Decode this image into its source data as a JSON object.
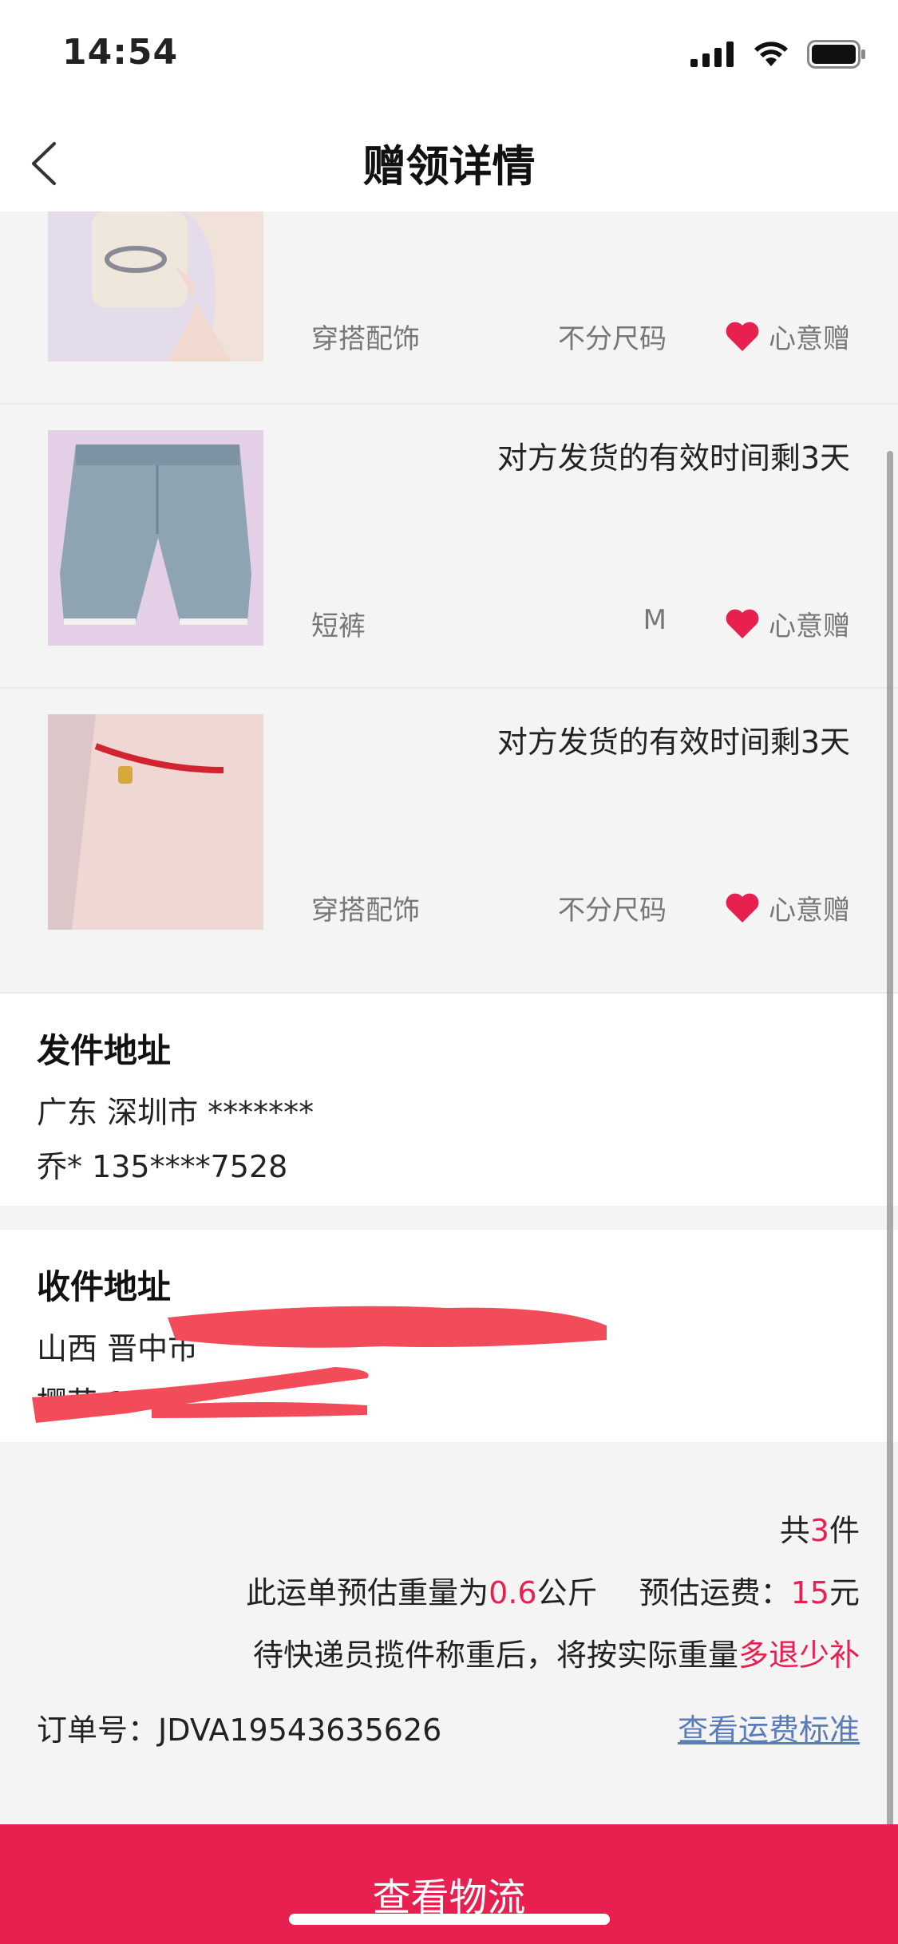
{
  "status_bar": {
    "time": "14:54"
  },
  "nav": {
    "title": "赠领详情"
  },
  "items": [
    {
      "category": "穿搭配饰",
      "size": "不分尺码",
      "badge": "心意赠",
      "remaining": "",
      "image": "ring-photo"
    },
    {
      "category": "短裤",
      "size": "M",
      "badge": "心意赠",
      "remaining": "对方发货的有效时间剩3天",
      "image": "denim-shorts-photo"
    },
    {
      "category": "穿搭配饰",
      "size": "不分尺码",
      "badge": "心意赠",
      "remaining": "对方发货的有效时间剩3天",
      "image": "red-bracelet-photo"
    }
  ],
  "sender": {
    "heading": "发件地址",
    "line1": "广东 深圳市 *******",
    "line2": "乔* 135****7528"
  },
  "receiver": {
    "heading": "收件地址",
    "line1": "山西 晋中市",
    "line2": "樱花 1"
  },
  "summary": {
    "count_prefix": "共",
    "count": "3",
    "count_suffix": "件",
    "weight_prefix": "此运单预估重量为",
    "weight": "0.6",
    "weight_unit": "公斤",
    "fee_prefix": "预估运费：",
    "fee": "15",
    "fee_unit": "元",
    "note_prefix": "待快递员揽件称重后，将按实际重量",
    "note_highlight": "多退少补",
    "order_label": "订单号：",
    "order_no": "JDVA19543635626",
    "fee_link": "查看运费标准"
  },
  "bottom_button": "查看物流",
  "colors": {
    "accent": "#e8204f",
    "link": "#5a7cb8",
    "heart": "#e8204f"
  }
}
